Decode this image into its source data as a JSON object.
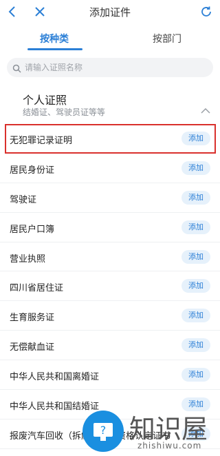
{
  "header": {
    "title": "添加证件"
  },
  "tabs": [
    {
      "label": "按种类"
    },
    {
      "label": "按部门"
    }
  ],
  "search": {
    "placeholder": "请输入证照名称"
  },
  "section": {
    "title": "个人证照",
    "subtitle": "结婚证、驾驶员证等等"
  },
  "items": [
    {
      "label": "无犯罪记录证明",
      "action": "添加"
    },
    {
      "label": "居民身份证",
      "action": "添加"
    },
    {
      "label": "驾驶证",
      "action": "添加"
    },
    {
      "label": "居民户口簿",
      "action": "添加"
    },
    {
      "label": "营业执照",
      "action": "添加"
    },
    {
      "label": "四川省居住证",
      "action": "添加"
    },
    {
      "label": "生育服务证",
      "action": "添加"
    },
    {
      "label": "无偿献血证",
      "action": "添加"
    },
    {
      "label": "中华人民共和国离婚证",
      "action": "添加"
    },
    {
      "label": "中华人民共和国结婚证",
      "action": "添加"
    },
    {
      "label": "报废汽车回收（拆解）企业资格认定证书",
      "action": "添加"
    }
  ],
  "watermark": {
    "text": "知识屋",
    "sub": "zhishiwu.com"
  },
  "colors": {
    "accent": "#2b7fd6",
    "highlight": "#d9302c",
    "add_bg": "#e6f1fb"
  }
}
